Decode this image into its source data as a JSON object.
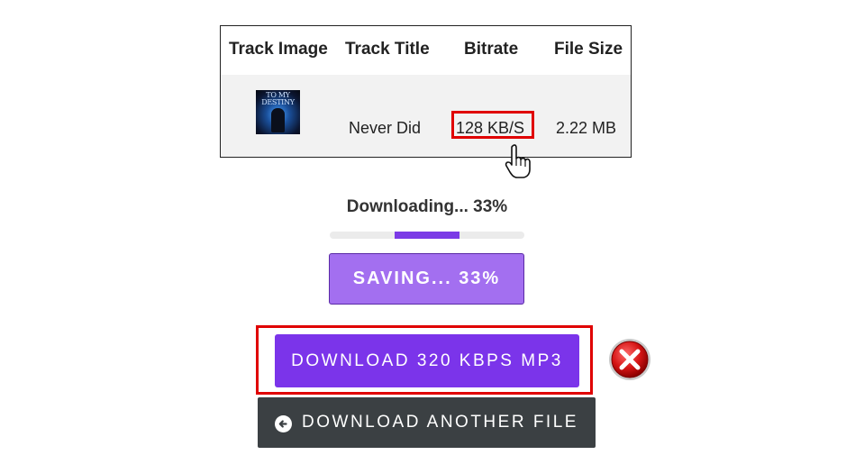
{
  "table": {
    "headers": [
      "Track Image",
      "Track Title",
      "Bitrate",
      "File Size"
    ],
    "row": {
      "album_art_text": "TO MY DESTINY",
      "track_title": "Never Did",
      "bitrate": "128 KB/S",
      "file_size": "2.22 MB"
    }
  },
  "progress": {
    "label": "Downloading... 33%",
    "percent": 33
  },
  "buttons": {
    "saving": "SAVING... 33%",
    "download_320": "DOWNLOAD 320 KBPS MP3",
    "download_another": "DOWNLOAD ANOTHER FILE"
  },
  "icons": {
    "cursor": "hand-pointer-icon",
    "error": "red-x-error-icon",
    "back": "arrow-left-circle-icon"
  },
  "colors": {
    "accent_purple": "#7b34ea",
    "saving_purple": "#a36ff0",
    "highlight_red": "#e00000",
    "dark_button": "#3b4043"
  }
}
